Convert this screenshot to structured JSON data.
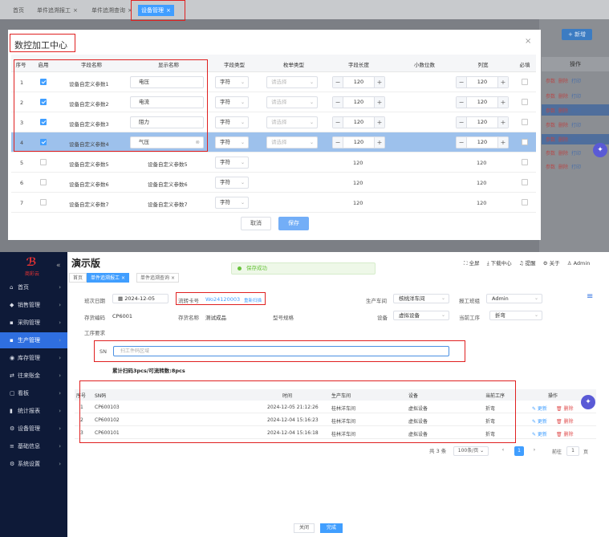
{
  "top": {
    "tabs": [
      {
        "label": "首页"
      },
      {
        "label": "单件追溯报工",
        "close": "×"
      },
      {
        "label": "单件追溯查询",
        "close": "×"
      },
      {
        "label": "设备管理",
        "close": "×"
      }
    ],
    "new_button": "+ 新增",
    "op_header": "操作",
    "op_row": {
      "a": "参数",
      "b": "删除",
      "c": "打印"
    },
    "dialog": {
      "title": "数控加工中心",
      "close": "×",
      "columns": [
        "序号",
        "启用",
        "字段名称",
        "显示名称",
        "字段类型",
        "枚举类型",
        "字段长度",
        "小数位数",
        "列宽",
        "必填"
      ],
      "rows": [
        {
          "no": "1",
          "enabled": true,
          "field": "设备自定义参数1",
          "display": "电压",
          "type": "字符",
          "enum": "请选择",
          "length": "120",
          "width": "120",
          "editable": true
        },
        {
          "no": "2",
          "enabled": true,
          "field": "设备自定义参数2",
          "display": "电流",
          "type": "字符",
          "enum": "请选择",
          "length": "120",
          "width": "120",
          "editable": true
        },
        {
          "no": "3",
          "enabled": true,
          "field": "设备自定义参数3",
          "display": "阻力",
          "type": "字符",
          "enum": "请选择",
          "length": "120",
          "width": "120",
          "editable": true
        },
        {
          "no": "4",
          "enabled": true,
          "field": "设备自定义参数4",
          "display": "气压",
          "type": "字符",
          "enum": "请选择",
          "length": "120",
          "width": "120",
          "editable": true
        },
        {
          "no": "5",
          "enabled": false,
          "field": "设备自定义参数5",
          "display": "设备自定义参数5",
          "type": "字符",
          "enum": "",
          "length": "120",
          "width": "120",
          "editable": false
        },
        {
          "no": "6",
          "enabled": false,
          "field": "设备自定义参数6",
          "display": "设备自定义参数6",
          "type": "字符",
          "enum": "",
          "length": "120",
          "width": "120",
          "editable": false
        },
        {
          "no": "7",
          "enabled": false,
          "field": "设备自定义参数7",
          "display": "设备自定义参数7",
          "type": "字符",
          "enum": "",
          "length": "120",
          "width": "120",
          "editable": false
        }
      ],
      "cancel": "取消",
      "save": "保存"
    }
  },
  "bottom": {
    "logo": "商彩云",
    "collapse": "«",
    "nav": [
      {
        "label": "首页",
        "icon": "⌂"
      },
      {
        "label": "销售管理",
        "icon": "◆"
      },
      {
        "label": "采购管理",
        "icon": "▪"
      },
      {
        "label": "生产管理",
        "icon": "▪"
      },
      {
        "label": "库存管理",
        "icon": "◉"
      },
      {
        "label": "往来账金",
        "icon": "⇄"
      },
      {
        "label": "看板",
        "icon": "▢"
      },
      {
        "label": "统计报表",
        "icon": "▮"
      },
      {
        "label": "设备管理",
        "icon": "⚙"
      },
      {
        "label": "基础信息",
        "icon": "≡"
      },
      {
        "label": "系统设置",
        "icon": "⚙"
      }
    ],
    "app_title": "演示版",
    "header_right": {
      "fullscreen": "⛶ 全屏",
      "download": "⤓ 下载中心",
      "notice": "♫ 提醒",
      "about": "⚙ 关于",
      "user": "♙ Admin"
    },
    "tabs": [
      {
        "label": "首页"
      },
      {
        "label": "单件追溯报工",
        "close": "×"
      },
      {
        "label": "单件追溯查询",
        "close": "×"
      }
    ],
    "toast": "保存成功",
    "form": {
      "date_label": "班次日期",
      "date_value": "2024-12-05",
      "card_label": "流转卡号",
      "card_value": "Wo24120003",
      "card_link": "重新扫描",
      "workshop_label": "生产车间",
      "workshop_value": "核桃洋车间",
      "team_label": "报工班组",
      "team_value": "Admin",
      "code_label": "存货编码",
      "code_value": "CP6001",
      "name_label": "存货名称",
      "name_value": "测试成品",
      "spec_label": "型号规格",
      "device_label": "设备",
      "device_value": "虚拟设备",
      "process_label": "当前工序",
      "process_value": "折弯",
      "req_label": "工序要求",
      "sn_label": "SN",
      "sn_placeholder": "扫工件码区域",
      "progress": "累计扫码3pcs/可流转数:8pcs"
    },
    "list": {
      "columns": [
        "序号",
        "SN码",
        "时间",
        "生产车间",
        "设备",
        "当前工序",
        "操作"
      ],
      "rows": [
        {
          "no": "1",
          "sn": "CP600103",
          "time": "2024-12-05 21:12:26",
          "workshop": "桂林洋车间",
          "device": "虚拟设备",
          "process": "折弯",
          "edit": "✎ 更新",
          "del": "🗑 删除"
        },
        {
          "no": "2",
          "sn": "CP600102",
          "time": "2024-12-04 15:16:23",
          "workshop": "桂林洋车间",
          "device": "虚拟设备",
          "process": "折弯",
          "edit": "✎ 更新",
          "del": "🗑 删除"
        },
        {
          "no": "3",
          "sn": "CP600101",
          "time": "2024-12-04 15:16:18",
          "workshop": "桂林洋车间",
          "device": "虚拟设备",
          "process": "折弯",
          "edit": "✎ 更新",
          "del": "🗑 删除"
        }
      ]
    },
    "pager": {
      "total": "共 3 条",
      "size": "100条/页",
      "prev": "‹",
      "page": "1",
      "next": "›",
      "goto": "前往",
      "goto_value": "1",
      "unit": "页"
    },
    "close_btn": "关闭",
    "done_btn": "完成"
  }
}
